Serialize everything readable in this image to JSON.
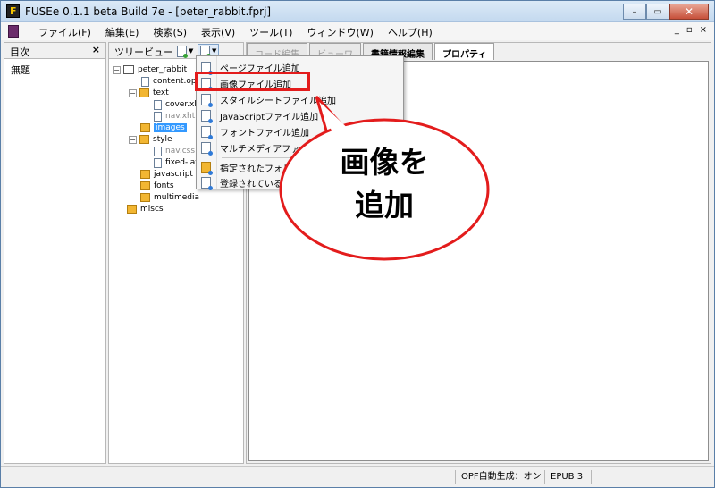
{
  "window": {
    "title": "FUSEe 0.1.1 beta Build 7e - [peter_rabbit.fprj]",
    "app_icon_letter": "F",
    "controls": {
      "minimize": "–",
      "restore": "▭",
      "close": "✕"
    }
  },
  "menubar": {
    "items": [
      "ファイル(F)",
      "編集(E)",
      "検索(S)",
      "表示(V)",
      "ツール(T)",
      "ウィンドウ(W)",
      "ヘルプ(H)"
    ],
    "mdi_controls": [
      "_",
      "▫",
      "×"
    ]
  },
  "left_panel": {
    "title": "目次",
    "close": "×",
    "items": [
      "無題"
    ]
  },
  "tree_panel": {
    "title": "ツリービュー",
    "nodes": {
      "root": "peter_rabbit",
      "content_opf": "content.opf",
      "text": "text",
      "cover": "cover.xhtml",
      "nav_xhtml": "nav.xhtml",
      "images": "images",
      "style": "style",
      "nav_css": "nav.css",
      "fixed": "fixed-layout",
      "javascript": "javascript",
      "fonts": "fonts",
      "multimedia": "multimedia",
      "miscs": "miscs"
    }
  },
  "tabs": [
    "コード編集",
    "ビューワ",
    "書籍情報編集",
    "プロパティ"
  ],
  "dropdown": {
    "items": [
      "ページファイル追加",
      "画像ファイル追加",
      "スタイルシートファイル追加",
      "JavaScriptファイル追加",
      "フォントファイル追加",
      "マルチメディアファイル追加",
      "指定されたフォルダ",
      "登録されている"
    ]
  },
  "callout": {
    "line1": "画像を",
    "line2": "追加"
  },
  "statusbar": {
    "opf_auto": "OPF自動生成：オン",
    "epub_version": "EPUB 3"
  }
}
